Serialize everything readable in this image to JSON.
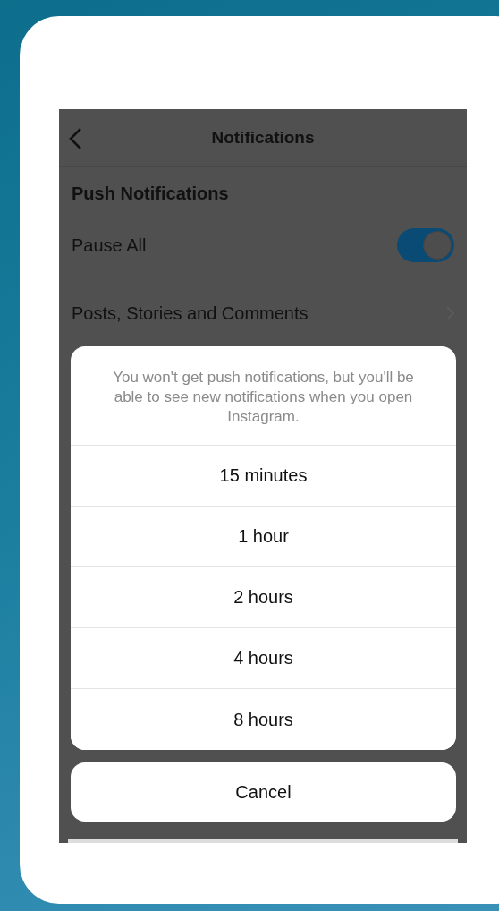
{
  "screen": {
    "title": "Notifications",
    "section_title": "Push Notifications",
    "rows": [
      {
        "kind": "toggle",
        "label": "Pause All",
        "on": true
      },
      {
        "kind": "link",
        "label": "Posts, Stories and Comments"
      }
    ]
  },
  "action_sheet": {
    "message": "You won't get push notifications, but you'll be able to see new notifications when you open Instagram.",
    "options": [
      "15 minutes",
      "1 hour",
      "2 hours",
      "4 hours",
      "8 hours"
    ],
    "cancel": "Cancel"
  }
}
